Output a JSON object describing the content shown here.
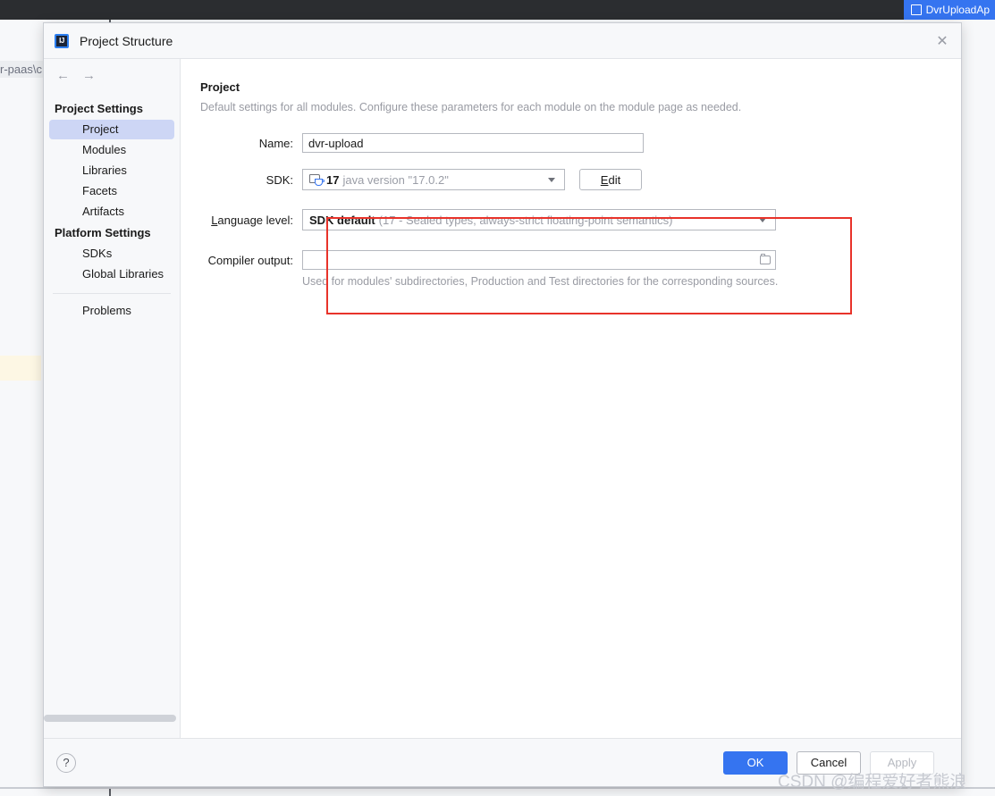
{
  "background": {
    "tab_label": "DvrUploadAp",
    "path_fragment": "r-paas\\c"
  },
  "dialog": {
    "title": "Project Structure",
    "app_icon": "IJ",
    "close_icon": "✕",
    "nav": {
      "back_icon": "←",
      "forward_icon": "→"
    }
  },
  "sidebar": {
    "groups": [
      {
        "label": "Project Settings",
        "items": [
          {
            "label": "Project",
            "selected": true
          },
          {
            "label": "Modules",
            "selected": false
          },
          {
            "label": "Libraries",
            "selected": false
          },
          {
            "label": "Facets",
            "selected": false
          },
          {
            "label": "Artifacts",
            "selected": false
          }
        ]
      },
      {
        "label": "Platform Settings",
        "items": [
          {
            "label": "SDKs",
            "selected": false
          },
          {
            "label": "Global Libraries",
            "selected": false
          }
        ]
      }
    ],
    "extra_items": [
      {
        "label": "Problems",
        "selected": false
      }
    ]
  },
  "main": {
    "title": "Project",
    "description": "Default settings for all modules. Configure these parameters for each module on the module page as needed.",
    "name_field": {
      "label": "Name:",
      "value": "dvr-upload"
    },
    "sdk_field": {
      "label": "SDK:",
      "version": "17",
      "detail": "java version \"17.0.2\"",
      "edit_button": "Edit",
      "edit_button_mnemonic": "E",
      "edit_button_rest": "dit"
    },
    "language_level_field": {
      "label_mnemonic": "L",
      "label_rest": "anguage level:",
      "value": "SDK default",
      "detail": "(17 - Sealed types, always-strict floating-point semantics)"
    },
    "compiler_output_field": {
      "label": "Compiler output:",
      "value": "",
      "placeholder": "",
      "hint": "Used for modules' subdirectories, Production and Test directories for the corresponding sources."
    }
  },
  "footer": {
    "help_label": "?",
    "ok_label": "OK",
    "cancel_label": "Cancel",
    "apply_label": "Apply"
  },
  "watermark": {
    "text": "CSDN @编程爱好者熊浪"
  },
  "colors": {
    "accent_blue": "#3574f0",
    "annotation_red": "#e8332a",
    "selection_blue": "#cdd6f5",
    "muted_text": "#9a9da6"
  }
}
